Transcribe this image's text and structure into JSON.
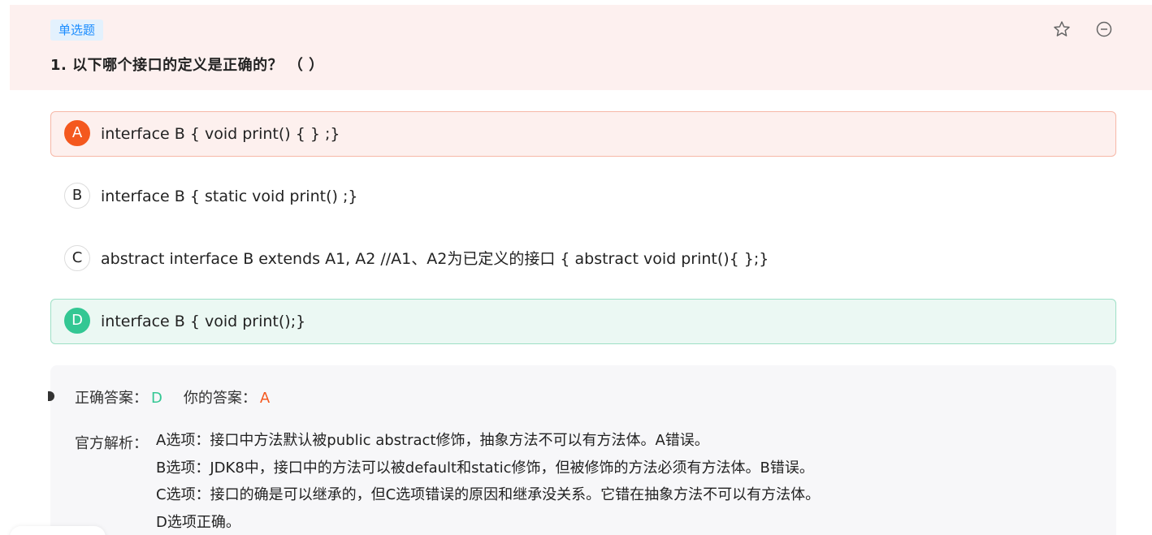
{
  "question": {
    "type_label": "单选题",
    "title": "1. 以下哪个接口的定义是正确的？ （ ）"
  },
  "options": [
    {
      "letter": "A",
      "text": "interface B { void print() { } ;}",
      "state": "wrong"
    },
    {
      "letter": "B",
      "text": "interface B { static void print() ;}",
      "state": "normal"
    },
    {
      "letter": "C",
      "text": "abstract interface B extends A1, A2 //A1、A2为已定义的接口 { abstract void print(){ };}",
      "state": "normal"
    },
    {
      "letter": "D",
      "text": "interface B { void print();}",
      "state": "right"
    }
  ],
  "result": {
    "correct_label": "正确答案：",
    "correct_value": "D",
    "your_label": "你的答案：",
    "your_value": "A"
  },
  "explanation": {
    "label": "官方解析：",
    "lines": [
      "A选项：接口中方法默认被public abstract修饰，抽象方法不可以有方法体。A错误。",
      "B选项：JDK8中，接口中的方法可以被default和static修饰，但被修饰的方法必须有方法体。B错误。",
      "C选项：接口的确是可以继承的，但C选项错误的原因和继承没关系。它错在抽象方法不可以有方法体。",
      "D选项正确。"
    ]
  },
  "icons": {
    "favorite": "star-icon",
    "remove": "minus-circle-icon"
  },
  "colors": {
    "wrong": "#f4581e",
    "right": "#33c793",
    "badge": "#1a8cff",
    "header_bg": "#fdf0ef"
  }
}
